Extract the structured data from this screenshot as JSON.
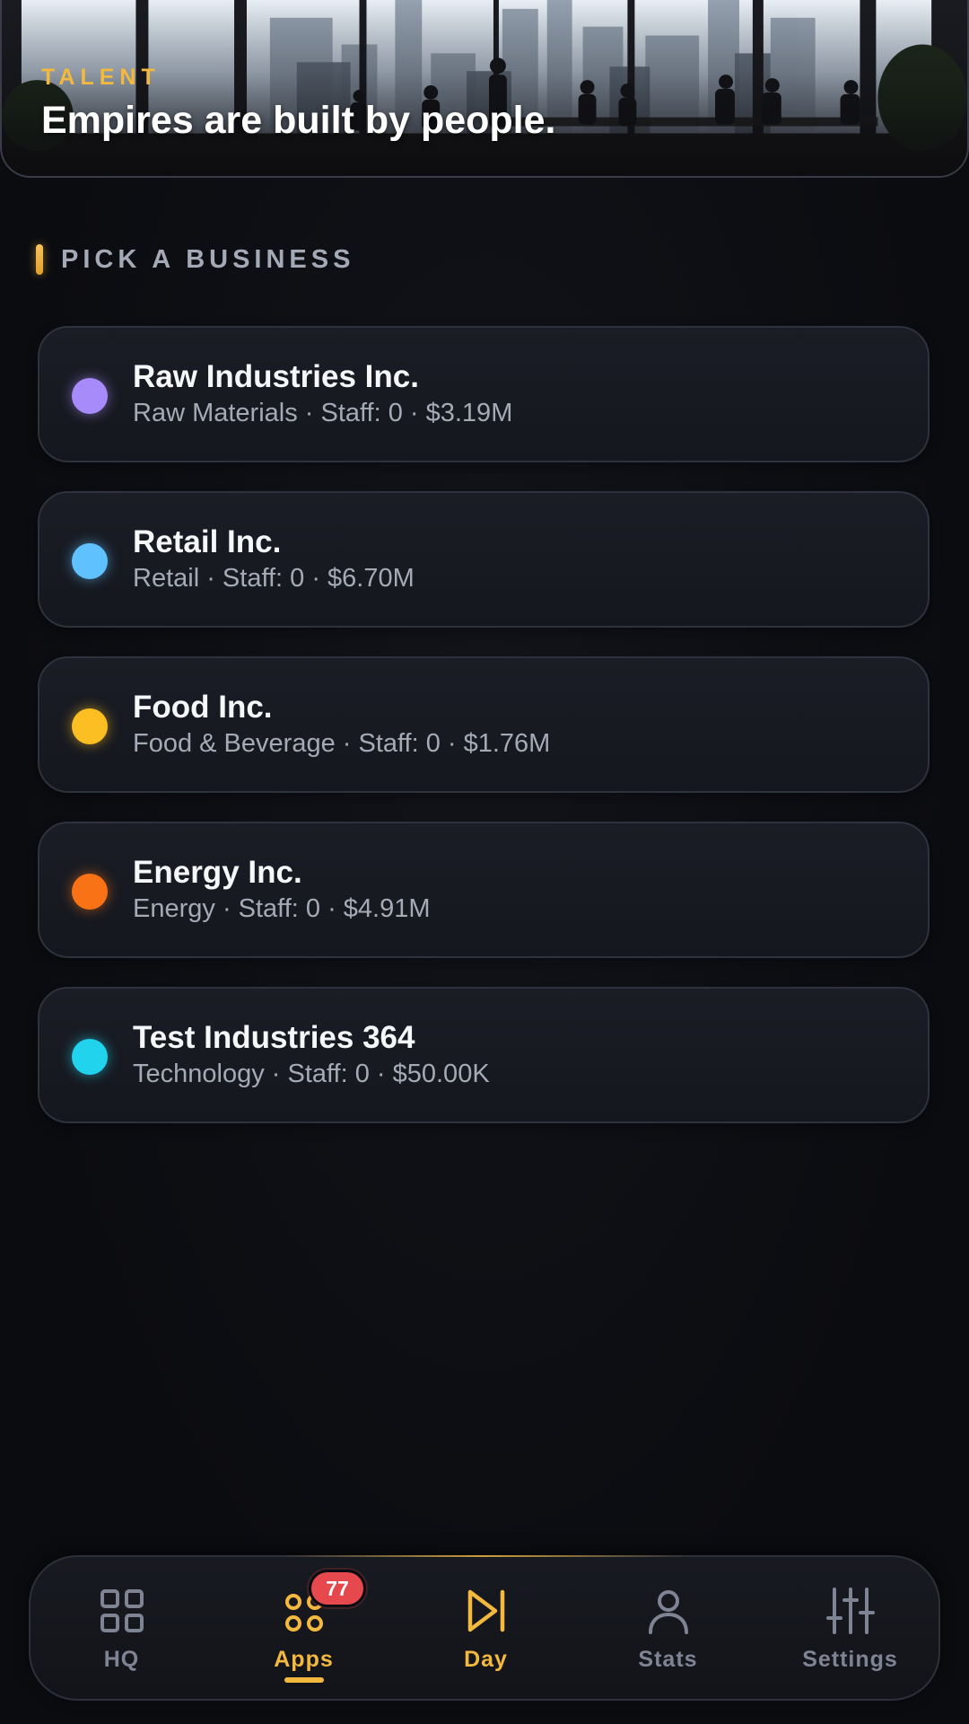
{
  "hero": {
    "eyebrow": "TALENT",
    "headline": "Empires are built by people."
  },
  "section": {
    "title": "PICK A BUSINESS"
  },
  "businesses": [
    {
      "name": "Raw Industries Inc.",
      "meta": "Raw Materials · Staff: 0 · $3.19M",
      "color": "#a78bfa"
    },
    {
      "name": "Retail Inc.",
      "meta": "Retail · Staff: 0 · $6.70M",
      "color": "#60c1ff"
    },
    {
      "name": "Food Inc.",
      "meta": "Food & Beverage · Staff: 0 · $1.76M",
      "color": "#fbbf24"
    },
    {
      "name": "Energy Inc.",
      "meta": "Energy · Staff: 0 · $4.91M",
      "color": "#f97316"
    },
    {
      "name": "Test Industries 364",
      "meta": "Technology · Staff: 0 · $50.00K",
      "color": "#22d3ee"
    }
  ],
  "nav": {
    "items": [
      {
        "label": "HQ",
        "icon": "grid-icon",
        "state": "inactive"
      },
      {
        "label": "Apps",
        "icon": "apps-icon",
        "state": "active"
      },
      {
        "label": "Day",
        "icon": "skip-forward-icon",
        "state": "highlight"
      },
      {
        "label": "Stats",
        "icon": "user-icon",
        "state": "inactive"
      },
      {
        "label": "Settings",
        "icon": "sliders-icon",
        "state": "inactive"
      }
    ],
    "apps_badge": "77"
  },
  "colors": {
    "accent": "#f3b93f",
    "badge": "#e5484d",
    "background": "#0b0c10",
    "card": "#1a1d25",
    "muted_text": "#a6aab6"
  }
}
